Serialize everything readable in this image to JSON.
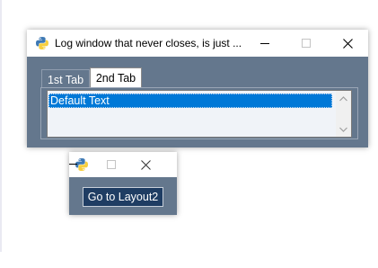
{
  "main_window": {
    "title": "Log window that never closes, is just ...",
    "icon": "python-icon",
    "controls": [
      "minimize-icon",
      "maximize-icon",
      "close-icon"
    ],
    "tabs": [
      {
        "label": "1st Tab",
        "selected": false
      },
      {
        "label": "2nd Tab",
        "selected": true
      }
    ],
    "listbox": {
      "items": [
        "Default Text"
      ],
      "selected_index": 0
    },
    "background_color": "#64778d"
  },
  "secondary_window": {
    "title": "",
    "icon": "python-icon",
    "controls": [
      "maximize-icon",
      "close-icon"
    ],
    "button_label": "Go to Layout2",
    "button_color": "#1f3d63"
  },
  "colors": {
    "selection": "#0078d7",
    "window_theme": "#64778d"
  }
}
